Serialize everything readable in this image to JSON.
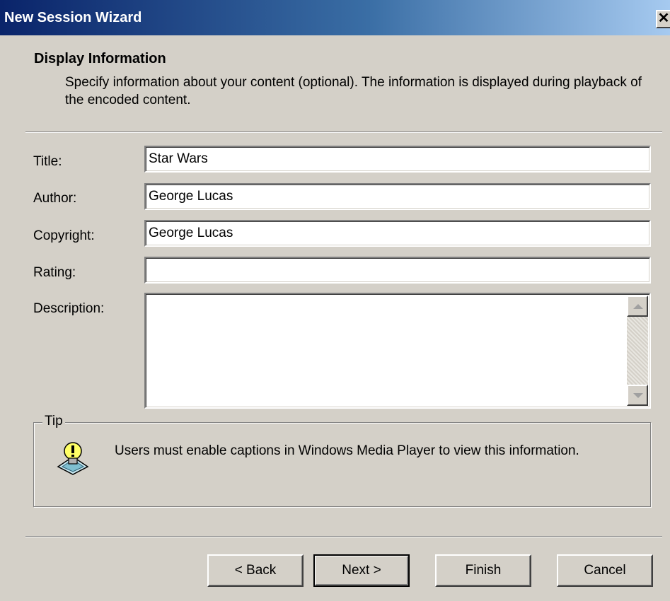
{
  "window": {
    "title": "New Session Wizard",
    "close_glyph": "✕"
  },
  "header": {
    "title": "Display Information",
    "description": "Specify information about your content (optional). The information is displayed during playback of the encoded content."
  },
  "form": {
    "title": {
      "label": "Title:",
      "value": "Star Wars"
    },
    "author": {
      "label": "Author:",
      "value": "George Lucas"
    },
    "copyright": {
      "label": "Copyright:",
      "value": "George Lucas"
    },
    "rating": {
      "label": "Rating:",
      "value": ""
    },
    "description": {
      "label": "Description:",
      "value": ""
    }
  },
  "tip": {
    "legend": "Tip",
    "text": "Users must enable captions in Windows Media Player to view this information.",
    "icon": "lightbulb-tip-icon"
  },
  "buttons": {
    "back": "< Back",
    "next": "Next >",
    "finish": "Finish",
    "cancel": "Cancel"
  },
  "colors": {
    "titlebar_start": "#0a246a",
    "titlebar_end": "#a6caf0",
    "dialog_bg": "#d4d0c8"
  }
}
